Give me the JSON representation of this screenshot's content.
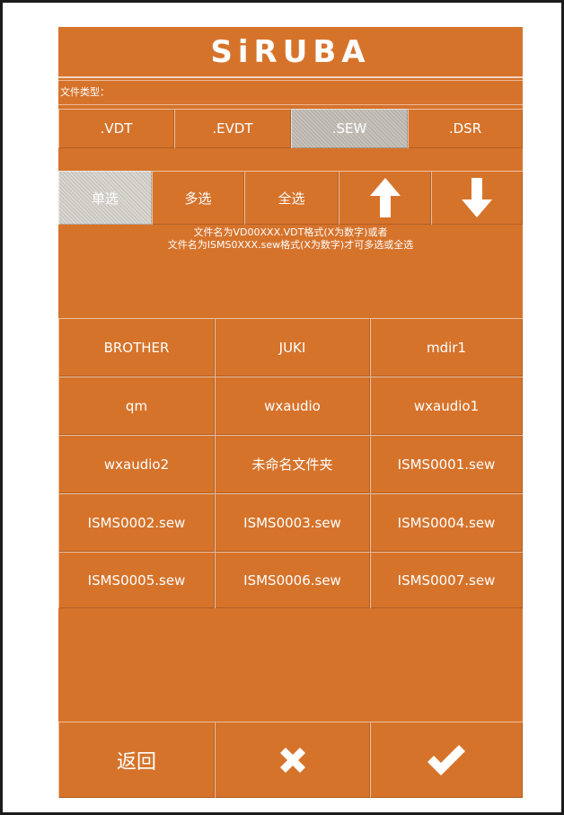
{
  "brand": {
    "logo_text": "SiRUBA"
  },
  "file_types": {
    "label": "文件类型：",
    "options": [
      ".VDT",
      ".EVDT",
      ".SEW",
      ".DSR"
    ],
    "selected": ".SEW"
  },
  "select_modes": {
    "options": [
      "单选",
      "多选",
      "全选"
    ],
    "selected": "单选",
    "up_icon": "arrow-up-icon",
    "down_icon": "arrow-down-icon"
  },
  "hint": {
    "line1": "文件名为VD00XXX.VDT格式(X为数字)或者",
    "line2": "文件名为ISMS0XXX.sew格式(X为数字)才可多选或全选"
  },
  "files": [
    "BROTHER",
    "JUKI",
    "mdir1",
    "qm",
    "wxaudio",
    "wxaudio1",
    "wxaudio2",
    "未命名文件夹",
    "ISMS0001.sew",
    "ISMS0002.sew",
    "ISMS0003.sew",
    "ISMS0004.sew",
    "ISMS0005.sew",
    "ISMS0006.sew",
    "ISMS0007.sew"
  ],
  "footer": {
    "back_label": "返回",
    "cancel_icon": "close-icon",
    "confirm_icon": "checkmark-icon"
  },
  "colors": {
    "panel": "#d6732b",
    "border": "#ffffff",
    "selected": "#d9d6d0",
    "frame": "#1b1b1b"
  }
}
